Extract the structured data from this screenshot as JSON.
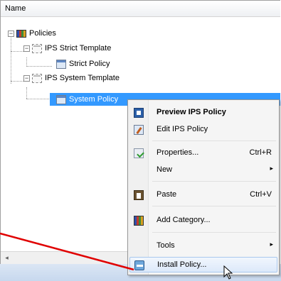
{
  "tree": {
    "column_header": "Name",
    "nodes": {
      "policies": "Policies",
      "strict_template": "IPS Strict Template",
      "strict_policy": "Strict Policy",
      "system_template": "IPS System Template",
      "system_policy": "System Policy"
    },
    "expander_symbol": "−"
  },
  "context_menu": {
    "items": [
      {
        "label": "Preview IPS Policy",
        "icon": "preview-icon",
        "bold": true
      },
      {
        "label": "Edit IPS Policy",
        "icon": "edit-icon"
      },
      {
        "label": "Properties...",
        "icon": "properties-icon",
        "shortcut": "Ctrl+R"
      },
      {
        "label": "New",
        "submenu": "▸"
      },
      {
        "label": "Paste",
        "icon": "paste-icon",
        "shortcut": "Ctrl+V"
      },
      {
        "label": "Add Category...",
        "icon": "add-category-icon"
      },
      {
        "label": "Tools",
        "submenu": "▸"
      },
      {
        "label": "Install Policy...",
        "icon": "install-policy-icon",
        "hovered": true
      }
    ]
  },
  "scrollbar": {
    "left_arrow": "◂"
  },
  "colors": {
    "selection": "#3399ff",
    "annotation_line": "#e00000",
    "menu_background": "#f5f5f5"
  }
}
